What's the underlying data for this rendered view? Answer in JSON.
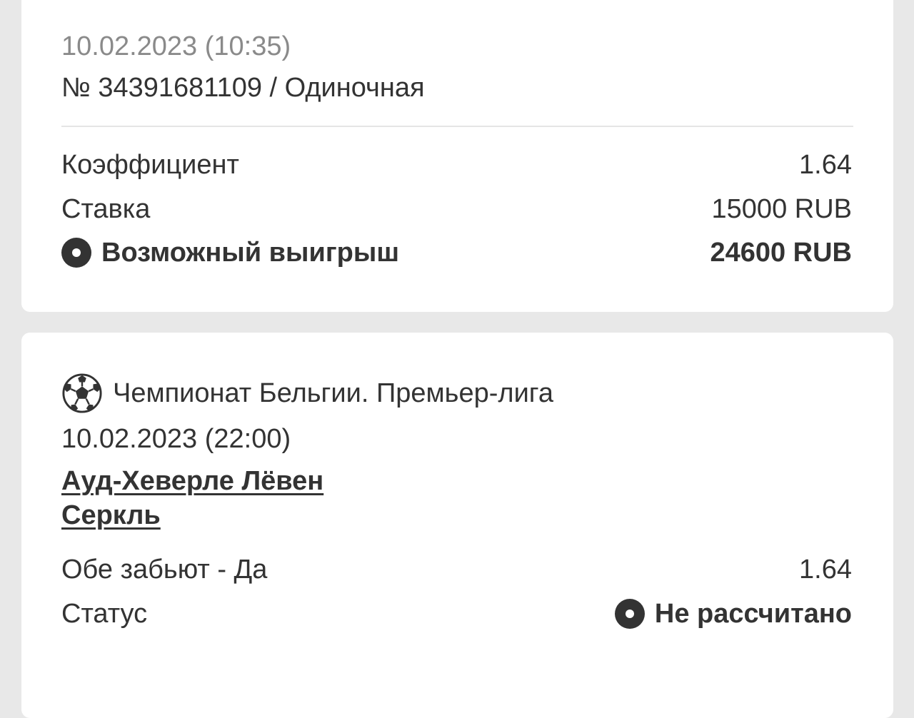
{
  "bet": {
    "datetime": "10.02.2023 (10:35)",
    "number_line": "№ 34391681109 / Одиночная",
    "coef_label": "Коэффициент",
    "coef_value": "1.64",
    "stake_label": "Ставка",
    "stake_value": "15000 RUB",
    "win_label": "Возможный выигрыш",
    "win_value": "24600 RUB"
  },
  "event": {
    "icon": "soccer-ball-icon",
    "league": "Чемпионат Бельгии. Премьер-лига",
    "datetime": "10.02.2023 (22:00)",
    "team1": "Ауд-Хеверле Лёвен",
    "team2": "Серкль",
    "outcome_label": "Обе забьют - Да",
    "outcome_value": "1.64",
    "status_label": "Статус",
    "status_value": "Не рассчитано"
  },
  "colors": {
    "background": "#e8e8e8",
    "card": "#ffffff",
    "text": "#333333",
    "muted": "#8a8a8a"
  }
}
